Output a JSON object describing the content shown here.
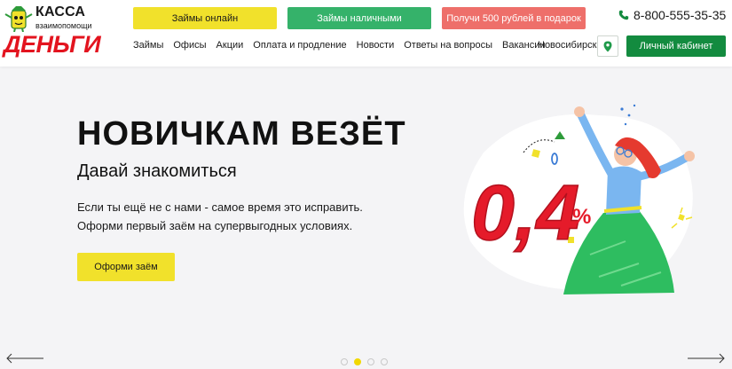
{
  "header": {
    "logo": {
      "top_text": "КАССА",
      "sub_text": "взаимопомощи",
      "main_text": "ДЕНЬГИ"
    },
    "buttons": {
      "online": "Займы онлайн",
      "cash": "Займы наличными",
      "gift": "Получи 500 рублей в подарок"
    },
    "phone": "8-800-555-35-35",
    "nav": [
      "Займы",
      "Офисы",
      "Акции",
      "Оплата и продление",
      "Новости",
      "Ответы на вопросы",
      "Вакансии"
    ],
    "city": "Новосибирск",
    "cabinet": "Личный кабинет"
  },
  "hero": {
    "title": "НОВИЧКАМ ВЕЗЁТ",
    "subtitle": "Давай знакомиться",
    "text_line1": "Если ты ещё не с нами - самое время это исправить.",
    "text_line2": "Оформи первый заём на супервыгодных условиях.",
    "cta": "Оформи заём",
    "rate_text": "0,4",
    "rate_unit": "%"
  },
  "carousel": {
    "slide_count": 4,
    "active_index": 1
  },
  "colors": {
    "yellow": "#f1e12b",
    "green": "#35b26a",
    "dark_green": "#138b3f",
    "coral": "#ee6f6a",
    "brand_red": "#e3141f"
  },
  "icons": {
    "phone": "phone-icon",
    "location": "location-pin-icon",
    "prev": "arrow-left-icon",
    "next": "arrow-right-icon"
  }
}
